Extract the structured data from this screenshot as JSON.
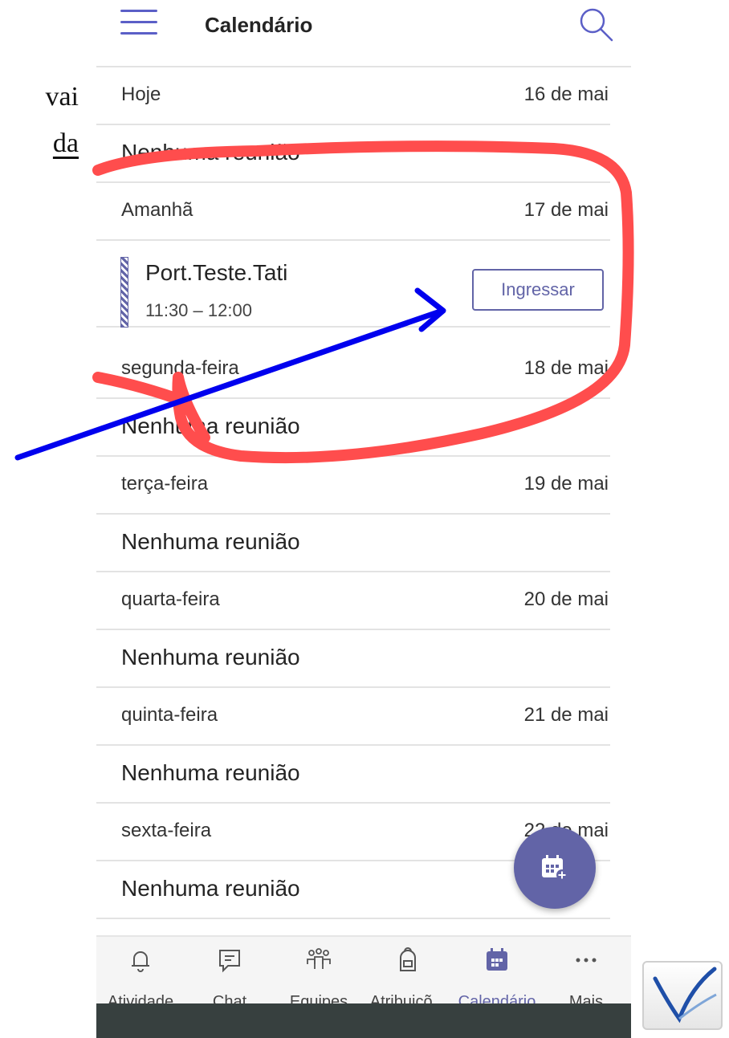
{
  "side_text": [
    "vai",
    "da"
  ],
  "header": {
    "title": "Calendário",
    "menu_icon": "hamburger-menu-icon",
    "search_icon": "search-icon"
  },
  "days": [
    {
      "name": "Hoje",
      "date": "16 de mai",
      "empty_text": "Nenhuma reunião"
    },
    {
      "name": "Amanhã",
      "date": "17 de mai"
    },
    {
      "name": "segunda-feira",
      "date": "18 de mai",
      "empty_text": "Nenhuma reunião"
    },
    {
      "name": "terça-feira",
      "date": "19 de mai",
      "empty_text": "Nenhuma reunião"
    },
    {
      "name": "quarta-feira",
      "date": "20 de mai",
      "empty_text": "Nenhuma reunião"
    },
    {
      "name": "quinta-feira",
      "date": "21 de mai",
      "empty_text": "Nenhuma reunião"
    },
    {
      "name": "sexta-feira",
      "date": "22 de mai",
      "empty_text": "Nenhuma reunião"
    }
  ],
  "meeting": {
    "title": "Port.Teste.Tati",
    "time": "11:30 – 12:00",
    "join_label": "Ingressar"
  },
  "fab": {
    "icon": "new-meeting-calendar-icon"
  },
  "tabs": [
    {
      "label": "Atividade",
      "icon": "bell-icon"
    },
    {
      "label": "Chat",
      "icon": "chat-icon"
    },
    {
      "label": "Equipes",
      "icon": "teams-icon"
    },
    {
      "label": "Atribuiçõ...",
      "icon": "backpack-icon"
    },
    {
      "label": "Calendário",
      "icon": "calendar-icon",
      "active": true
    },
    {
      "label": "Mais",
      "icon": "more-dots-icon"
    }
  ],
  "colors": {
    "accent": "#6264a7",
    "annotation_red": "#ff4d4d",
    "annotation_blue": "#0000ee"
  }
}
